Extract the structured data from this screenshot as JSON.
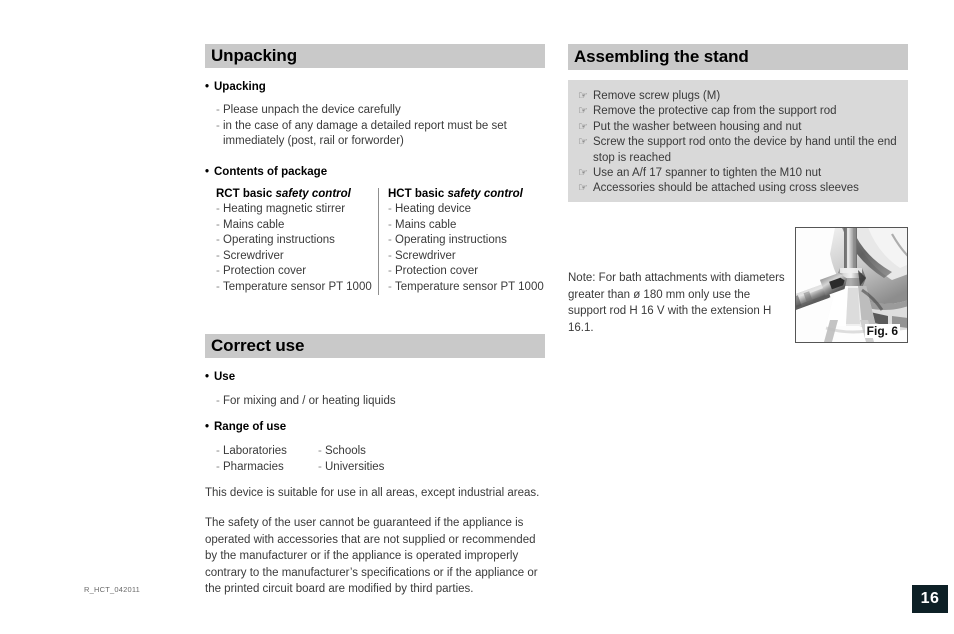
{
  "page": {
    "number": "16",
    "footer_code": "R_HCT_042011"
  },
  "left_column": {
    "unpacking": {
      "heading": "Unpacking",
      "groups": [
        {
          "label": "Upacking",
          "items": [
            "Please unpach the device carefully",
            "in the case of any damage a detailed report must be set",
            "immediately (post, rail or forworder)"
          ]
        },
        {
          "label": "Contents of package"
        }
      ],
      "package_columns": [
        {
          "title_bold": "RCT basic ",
          "title_italic": "safety control",
          "items": [
            "Heating magnetic stirrer",
            "Mains cable",
            "Operating instructions",
            "Screwdriver",
            "Protection cover",
            "Temperature sensor PT 1000"
          ]
        },
        {
          "title_bold": "HCT basic ",
          "title_italic": "safety control",
          "items": [
            "Heating device",
            "Mains cable",
            "Operating instructions",
            "Screwdriver",
            "Protection cover",
            "Temperature sensor PT 1000"
          ]
        }
      ]
    },
    "correct_use": {
      "heading": "Correct use",
      "use_label": "Use",
      "use_items": [
        "For mixing and / or heating liquids"
      ],
      "range_label": "Range of use",
      "range_column_1": [
        "Laboratories",
        "Pharmacies"
      ],
      "range_column_2": [
        "Schools",
        "Universities"
      ],
      "paragraph_1": "This device is suitable for use in all areas, except industrial areas.",
      "paragraph_2": "The safety of the user cannot be guaranteed if the appliance is operated with accessories that are not supplied or recommended by the manufacturer or if the appliance is operated improperly contrary to the manufacturer’s specifications or if the appliance or the printed circuit board are modified by third parties."
    }
  },
  "right_column": {
    "assembling": {
      "heading": "Assembling the stand",
      "bullet_icon": "pointing-hand-icon",
      "items": [
        "Remove screw plugs (M)",
        "Remove the protective cap from the support rod",
        "Put the washer between housing and nut",
        "Screw the support rod onto the device by hand until the end stop is reached",
        "Use an A/f 17 spanner to tighten the M10 nut",
        "Accessories should be attached using cross sleeves"
      ]
    },
    "note": "Note: For bath attachments with diameters greater than ø 180 mm only use the support rod H 16 V with the extension H 16.1.",
    "figure": {
      "caption": "Fig. 6",
      "alt": "spanner-tightening-support-rod-nut-photo"
    }
  },
  "colors": {
    "header_bar": "#c9c9c9",
    "list_box": "#d9d9d9",
    "page_badge": "#0d2026",
    "body_text": "#3a3a3a"
  }
}
